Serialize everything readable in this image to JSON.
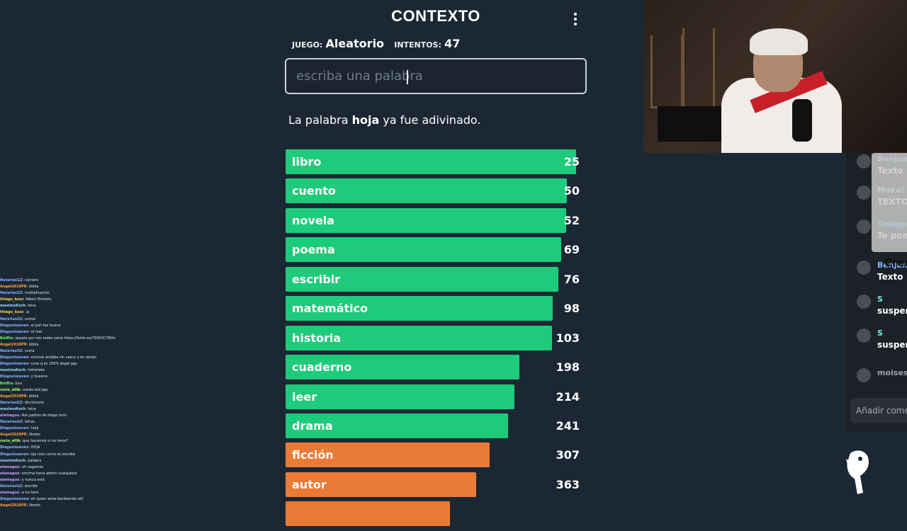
{
  "game": {
    "title": "CONTEXTO",
    "game_label": "JUEGO:",
    "game_value": "Aleatorio",
    "attempts_label": "INTENTOS:",
    "attempts_value": "47",
    "input_placeholder": "escriba una palabra",
    "message_prefix": "La palabra",
    "message_word": "hoja",
    "message_suffix": "ya fue adivinado.",
    "max_rank_scale": 420,
    "colors": {
      "green": "#1ecb7a",
      "orange": "#ea7b37",
      "bg": "#1b2834"
    },
    "guesses": [
      {
        "word": "libro",
        "rank": 25,
        "color": "green",
        "fill": 0.965
      },
      {
        "word": "cuento",
        "rank": 50,
        "color": "green",
        "fill": 0.935
      },
      {
        "word": "novela",
        "rank": 52,
        "color": "green",
        "fill": 0.932
      },
      {
        "word": "poema",
        "rank": 69,
        "color": "green",
        "fill": 0.915
      },
      {
        "word": "escribir",
        "rank": 76,
        "color": "green",
        "fill": 0.907
      },
      {
        "word": "matemático",
        "rank": 98,
        "color": "green",
        "fill": 0.888
      },
      {
        "word": "historia",
        "rank": 103,
        "color": "green",
        "fill": 0.884
      },
      {
        "word": "cuaderno",
        "rank": 198,
        "color": "green",
        "fill": 0.776
      },
      {
        "word": "leer",
        "rank": 214,
        "color": "green",
        "fill": 0.761
      },
      {
        "word": "drama",
        "rank": 241,
        "color": "green",
        "fill": 0.738
      },
      {
        "word": "ficción",
        "rank": 307,
        "color": "orange",
        "fill": 0.678
      },
      {
        "word": "autor",
        "rank": 363,
        "color": "orange",
        "fill": 0.634
      },
      {
        "word": "",
        "rank": "",
        "color": "orange",
        "fill": 0.546
      }
    ]
  },
  "left_chat": [
    {
      "user": "NatariasGZ",
      "text": ": número",
      "color": "#7fb2ff"
    },
    {
      "user": "Angel2010PR",
      "text": ": biblia",
      "color": "#ff9f40"
    },
    {
      "user": "NatariasGZ",
      "text": ": multiplicación",
      "color": "#7fb2ff"
    },
    {
      "user": "thiago_bzzz",
      "text": ": Albert Einstein",
      "color": "#ffd54a"
    },
    {
      "user": "maximoKoch",
      "text": ": letra",
      "color": "#9fd6ff"
    },
    {
      "user": "thiago_bzzz",
      "text": ": :p",
      "color": "#ffd54a"
    },
    {
      "user": "NatariasGZ",
      "text": ": sumar",
      "color": "#7fb2ff"
    },
    {
      "user": "Diegosisseven",
      "text": ": el poli fue bueno",
      "color": "#8ab4ff"
    },
    {
      "user": "Diegosisseven",
      "text": ": el mal",
      "color": "#8ab4ff"
    },
    {
      "user": "BotRix",
      "text": ": pasate por mis redes socio https://linktr.ee/70915CYRHn",
      "color": "#66ff66"
    },
    {
      "user": "Angel2010PR",
      "text": ": biblia",
      "color": "#ff9f40"
    },
    {
      "user": "NatariasGZ",
      "text": ": suma",
      "color": "#7fb2ff"
    },
    {
      "user": "Diegosisseven",
      "text": ": encima andaba sin casco y en ojotas",
      "color": "#8ab4ff"
    },
    {
      "user": "Diegosisseven",
      "text": ": cosa q es 100% ilegal jaja",
      "color": "#8ab4ff"
    },
    {
      "user": "maximoKoch",
      "text": ": historieta",
      "color": "#9fd6ff"
    },
    {
      "user": "Diegosisseven",
      "text": ": y bueeno",
      "color": "#8ab4ff"
    },
    {
      "user": "BotRix",
      "text": ": bve",
      "color": "#66ff66"
    },
    {
      "user": "rocio_allib",
      "text": ": medio bid jaja",
      "color": "#b3ff66"
    },
    {
      "user": "Angel2010PR",
      "text": ": biblia",
      "color": "#ff9f40"
    },
    {
      "user": "NatariasGZ",
      "text": ": diccionario",
      "color": "#7fb2ff"
    },
    {
      "user": "maximoKoch",
      "text": ": letra",
      "color": "#9fd6ff"
    },
    {
      "user": "alamagoo",
      "text": ": Are padres de diego tomi",
      "color": "#c79bff"
    },
    {
      "user": "NatariasGZ",
      "text": ": letras",
      "color": "#7fb2ff"
    },
    {
      "user": "Diegosisseven",
      "text": ": hoja",
      "color": "#8ab4ff"
    },
    {
      "user": "Angel2010PR",
      "text": ": libreto",
      "color": "#ff9f40"
    },
    {
      "user": "rocio_allib",
      "text": ": que hacemos si no tiene?",
      "color": "#b3ff66"
    },
    {
      "user": "Diegosisseven",
      "text": ": HOJA",
      "color": "#8ab4ff"
    },
    {
      "user": "Diegosisseven",
      "text": ": eja nooi como se escribe",
      "color": "#8ab4ff"
    },
    {
      "user": "maximoKoch",
      "text": ": palabra",
      "color": "#9fd6ff"
    },
    {
      "user": "alamagoo",
      "text": ": uh cagamos",
      "color": "#c79bff"
    },
    {
      "user": "alamagoo",
      "text": ": encima tiene admin cualquiera",
      "color": "#c79bff"
    },
    {
      "user": "alamagoo",
      "text": ": y nunca está",
      "color": "#c79bff"
    },
    {
      "user": "NatariasGZ",
      "text": ": escribir",
      "color": "#7fb2ff"
    },
    {
      "user": "alamagoo",
      "text": ": a no tomi",
      "color": "#c79bff"
    },
    {
      "user": "Diegosisseven",
      "text": ": eh quien anda bardeando ahí",
      "color": "#8ab4ff"
    },
    {
      "user": "Angel2010PR",
      "text": ": libreto",
      "color": "#ff9f40"
    }
  ],
  "right_chat": {
    "messages": [
      {
        "name": "Benjami",
        "text": "Texto",
        "name_color": "#7fb2ff"
      },
      {
        "name": "Moka!",
        "text": "TEXTO",
        "name_color": "#6cf0e0"
      },
      {
        "name": "Thiago",
        "text": "Te pong segund",
        "name_color": "#4fd0ff"
      },
      {
        "name": "Benjami",
        "text": "Texto",
        "name_color": "#7fb2ff"
      },
      {
        "name": "S",
        "text": "suspen",
        "name_color": "#6cf0e0"
      },
      {
        "name": "S",
        "text": "suspen",
        "name_color": "#6cf0e0"
      },
      {
        "name": "moises",
        "text": "",
        "name_color": "#9aa0a6"
      }
    ],
    "popup_text": "Crea",
    "input_placeholder": "Añadir come"
  }
}
